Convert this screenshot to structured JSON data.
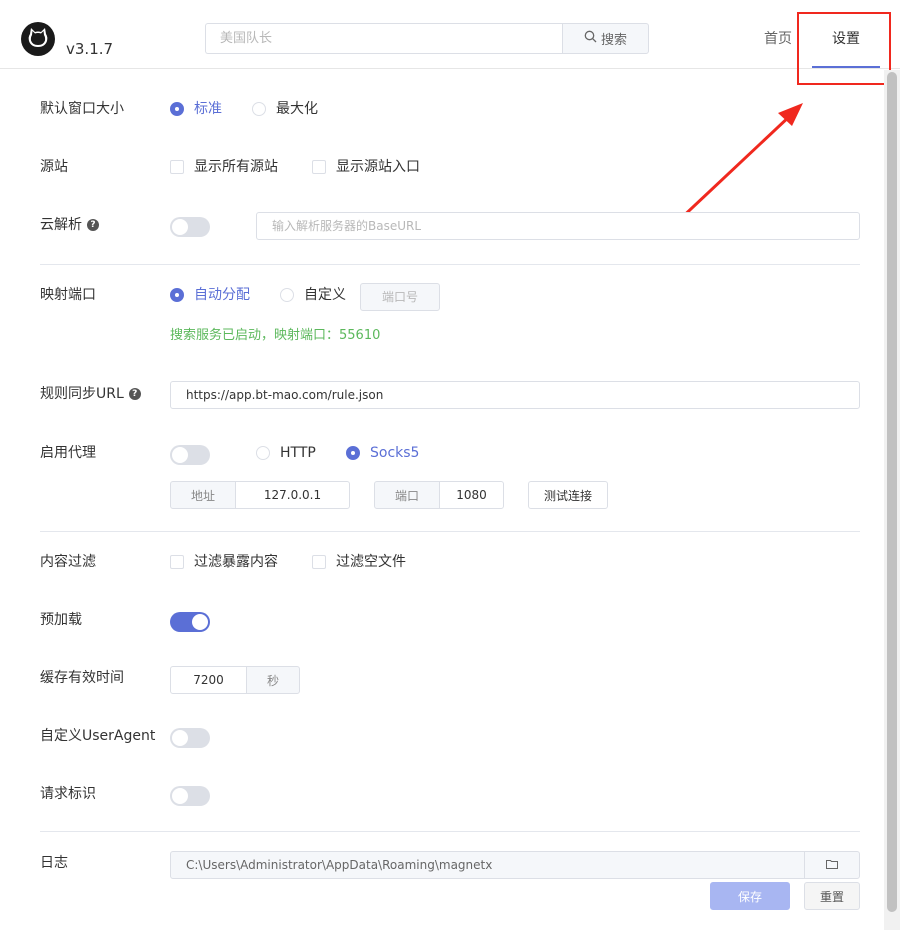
{
  "header": {
    "version": "v3.1.7",
    "search_placeholder": "美国队长",
    "search_button": "搜索",
    "nav_home": "首页",
    "nav_settings": "设置",
    "accent_color": "#5b6fd6",
    "annotation_color": "#f0281e"
  },
  "settings": {
    "window_size": {
      "label": "默认窗口大小",
      "options": [
        "标准",
        "最大化"
      ],
      "selected": "标准"
    },
    "source": {
      "label": "源站",
      "options": [
        "显示所有源站",
        "显示源站入口"
      ]
    },
    "cloud_parse": {
      "label": "云解析",
      "enabled": false,
      "placeholder": "输入解析服务器的BaseURL"
    },
    "port": {
      "label": "映射端口",
      "options": [
        "自动分配",
        "自定义"
      ],
      "selected": "自动分配",
      "port_placeholder": "端口号",
      "status": "搜索服务已启动，映射端口：55610"
    },
    "rule_sync": {
      "label": "规则同步URL",
      "value": "https://app.bt-mao.com/rule.json"
    },
    "proxy": {
      "label": "启用代理",
      "enabled": false,
      "protocols": [
        "HTTP",
        "Socks5"
      ],
      "selected": "Socks5",
      "address_label": "地址",
      "address": "127.0.0.1",
      "port_label": "端口",
      "port": "1080",
      "test_button": "测试连接"
    },
    "content_filter": {
      "label": "内容过滤",
      "options": [
        "过滤暴露内容",
        "过滤空文件"
      ]
    },
    "preload": {
      "label": "预加载",
      "enabled": true
    },
    "cache": {
      "label": "缓存有效时间",
      "value": "7200",
      "unit": "秒"
    },
    "user_agent": {
      "label": "自定义UserAgent",
      "enabled": false
    },
    "request_id": {
      "label": "请求标识",
      "enabled": false
    },
    "log": {
      "label": "日志",
      "path": "C:\\Users\\Administrator\\AppData\\Roaming\\magnetx"
    }
  },
  "actions": {
    "save": "保存",
    "reset": "重置"
  },
  "icons": {
    "logo": "cat-logo-icon",
    "search": "search-icon",
    "help": "question-circle-icon",
    "folder": "folder-icon"
  }
}
